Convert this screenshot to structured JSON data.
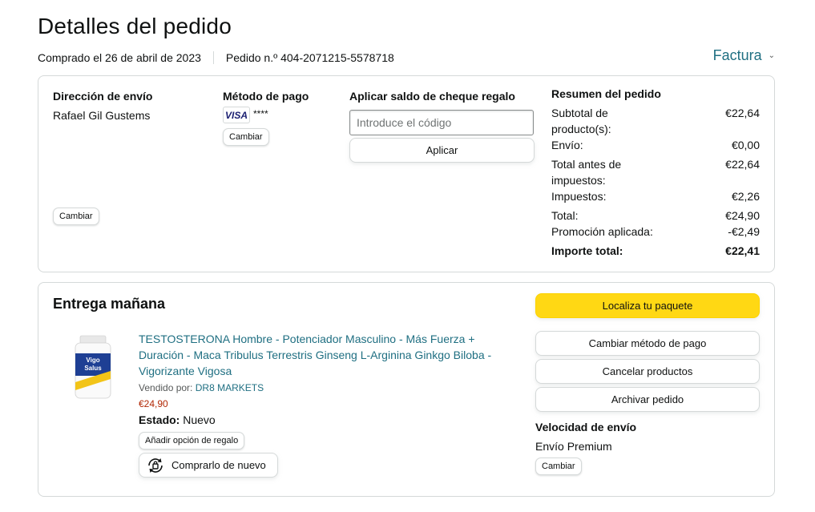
{
  "page": {
    "title": "Detalles del pedido",
    "purchased": "Comprado el 26 de abril de 2023",
    "order_number": "Pedido n.º 404-2071215-5578718",
    "invoice_label": "Factura"
  },
  "shipping": {
    "heading": "Dirección de envío",
    "name": "Rafael Gil Gustems",
    "change_label": "Cambiar"
  },
  "payment": {
    "heading": "Método de pago",
    "card_brand": "VISA",
    "card_mask": "****",
    "change_label": "Cambiar"
  },
  "gift": {
    "heading": "Aplicar saldo de cheque regalo",
    "placeholder": "Introduce el código",
    "apply_label": "Aplicar"
  },
  "summary": {
    "heading": "Resumen del pedido",
    "rows": [
      {
        "label": "Subtotal de producto(s):",
        "value": "€22,64"
      },
      {
        "label": "Envío:",
        "value": "€0,00"
      },
      {
        "label": "Total antes de impuestos:",
        "value": "€22,64"
      },
      {
        "label": "Impuestos:",
        "value": "€2,26"
      },
      {
        "label": "Total:",
        "value": "€24,90"
      },
      {
        "label": "Promoción aplicada:",
        "value": "-€2,49"
      }
    ],
    "grand_total_label": "Importe total:",
    "grand_total_value": "€22,41"
  },
  "delivery": {
    "heading": "Entrega mañana",
    "product": {
      "title": "TESTOSTERONA Hombre - Potenciador Masculino - Más Fuerza + Duración - Maca Tribulus Terrestris Ginseng L-Arginina Ginkgo Biloba - Vigorizante Vigosa",
      "image_brand": "Vigo Salus",
      "sold_by_label": "Vendido por:",
      "seller": "DR8 MARKETS",
      "price": "€24,90",
      "status_label": "Estado:",
      "status_value": "Nuevo",
      "gift_option_label": "Añadir opción de regalo",
      "buy_again_label": "Comprarlo de nuevo"
    },
    "actions": {
      "track": "Localiza tu paquete",
      "change_payment": "Cambiar método de pago",
      "cancel": "Cancelar productos",
      "archive": "Archivar pedido"
    },
    "speed": {
      "heading": "Velocidad de envío",
      "value": "Envío Premium",
      "change_label": "Cambiar"
    }
  },
  "colors": {
    "link": "#1f6f82",
    "price": "#b12704",
    "primary_button": "#ffd814",
    "border": "#d5d9d9"
  }
}
